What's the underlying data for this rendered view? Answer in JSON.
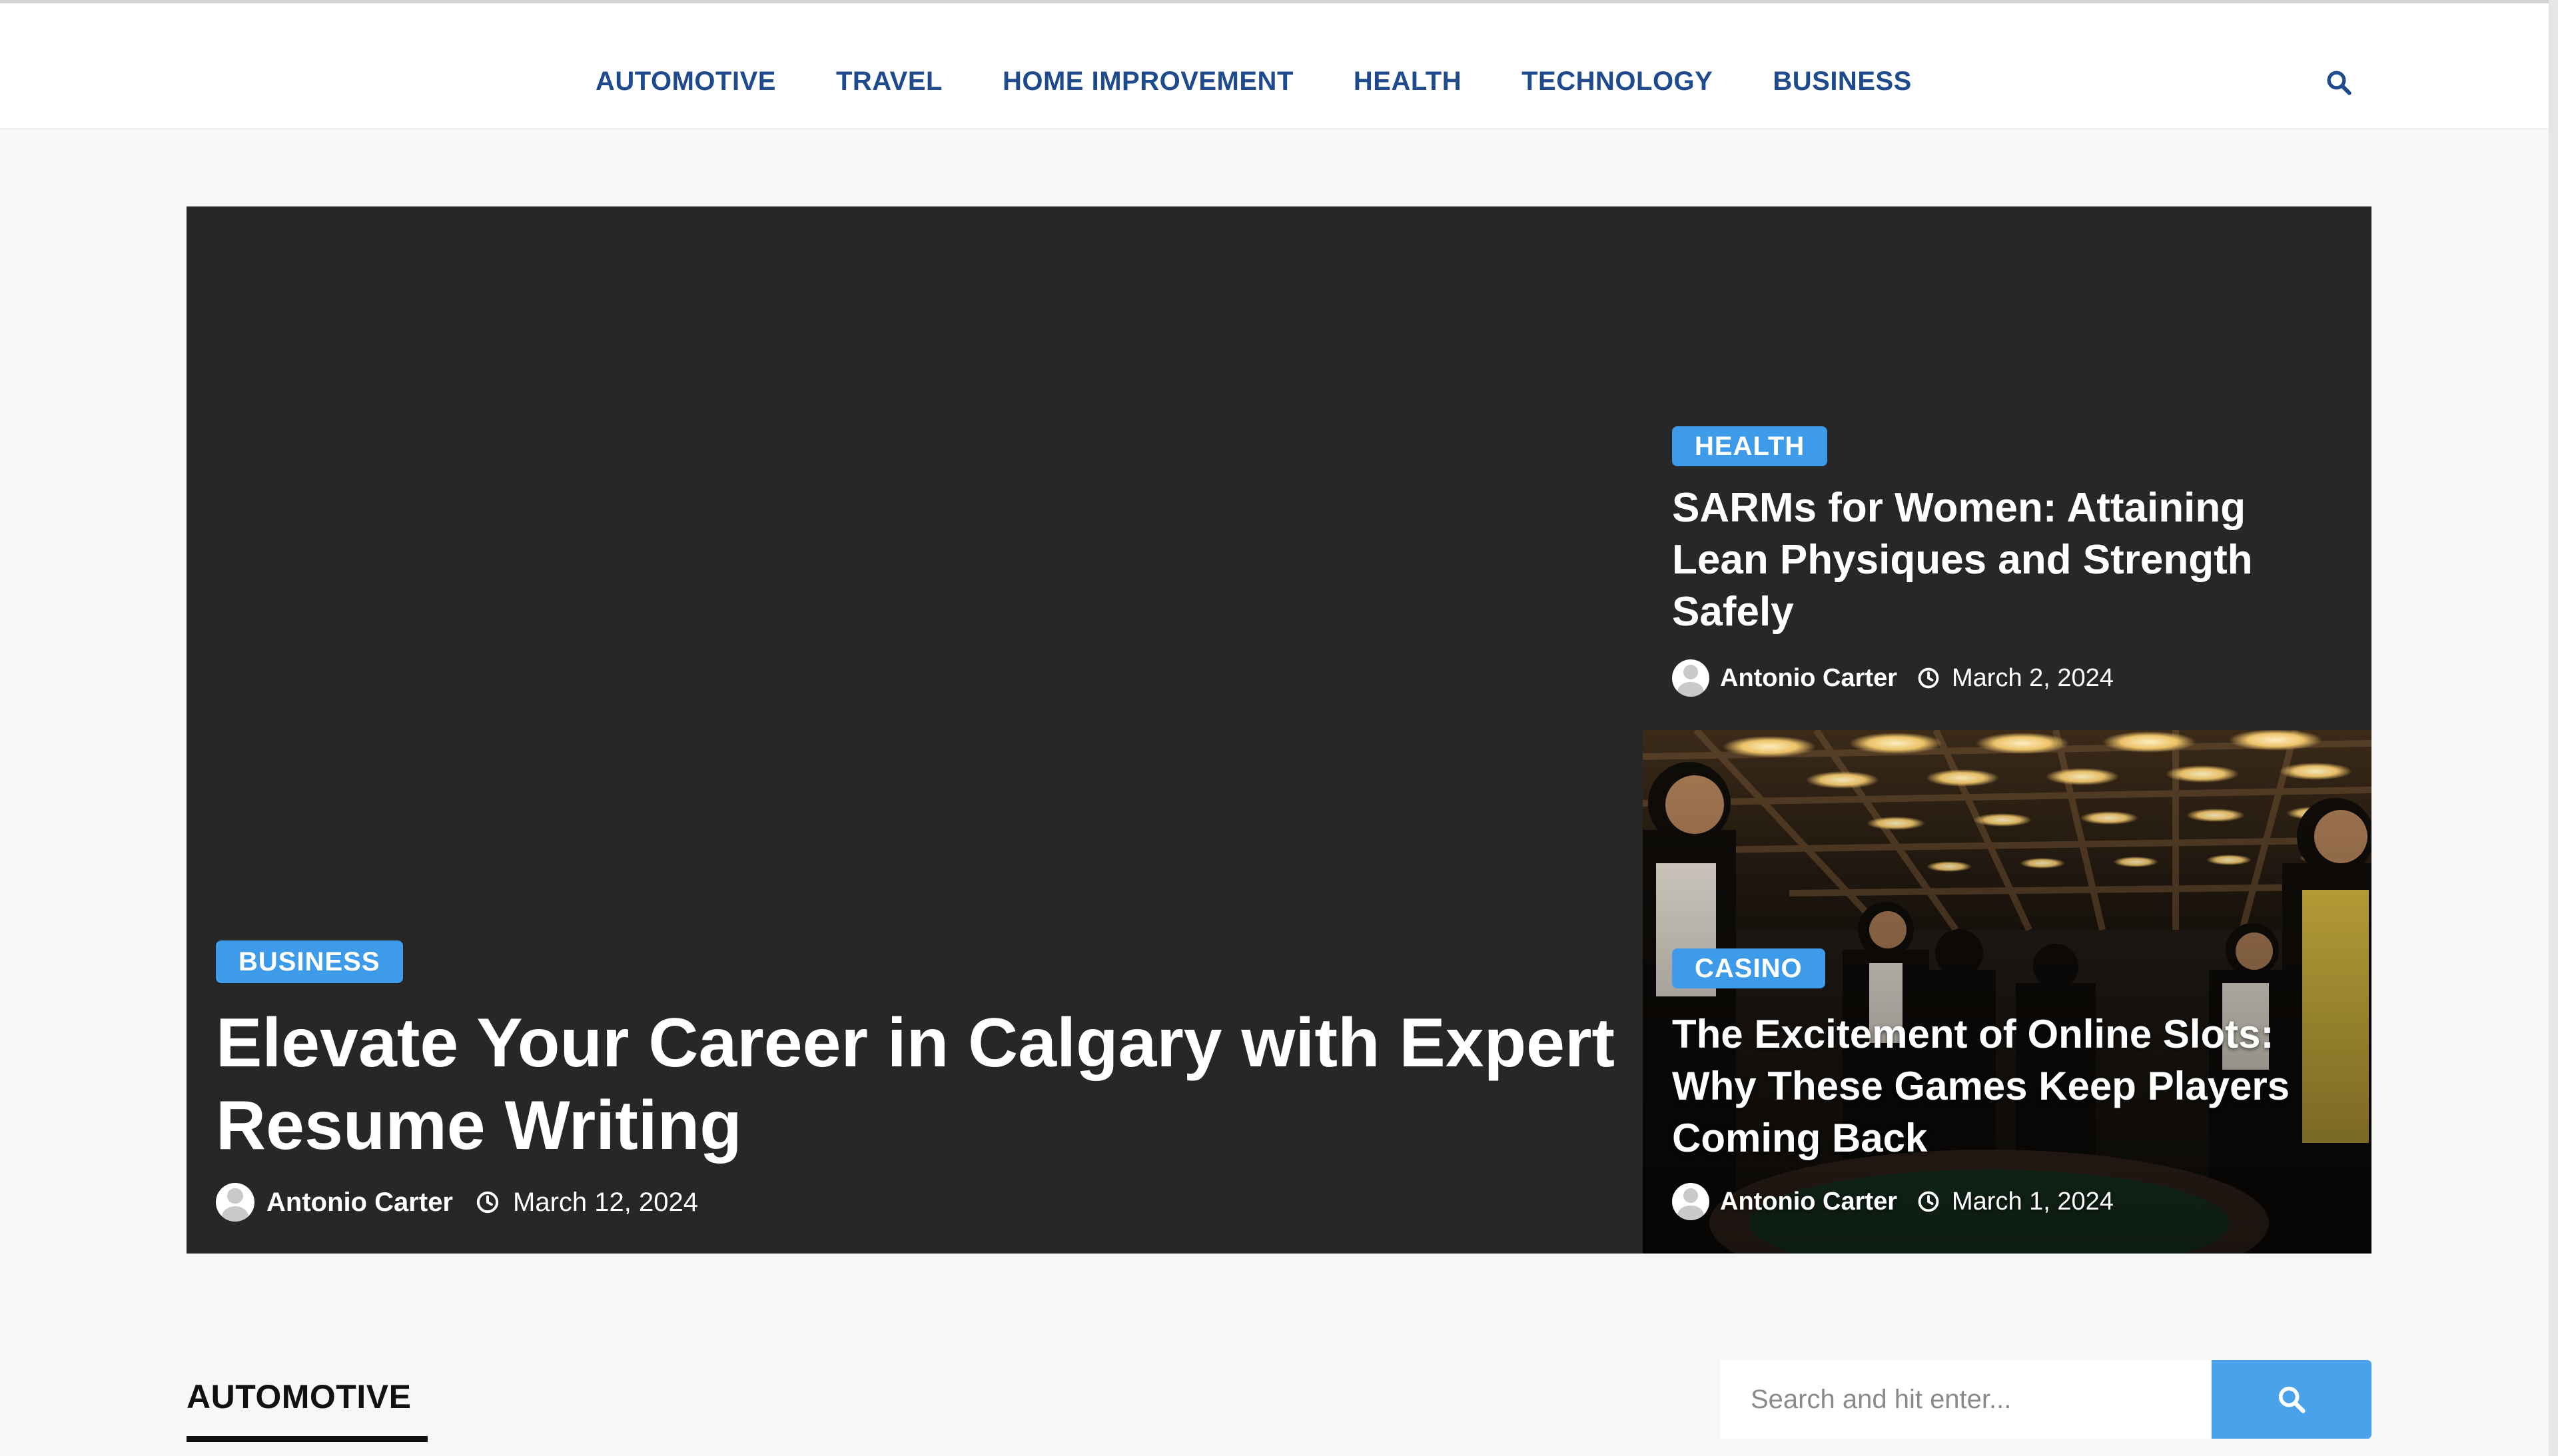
{
  "nav": {
    "items": [
      "AUTOMOTIVE",
      "TRAVEL",
      "HOME IMPROVEMENT",
      "HEALTH",
      "TECHNOLOGY",
      "BUSINESS"
    ],
    "search_icon": "search-icon"
  },
  "hero": {
    "main": {
      "category": "BUSINESS",
      "title": "Elevate Your Career in Calgary with Expert Resume Writing",
      "author": "Antonio Carter",
      "date": "March 12, 2024"
    },
    "side1": {
      "category": "HEALTH",
      "title": "SARMs for Women: Attaining Lean Physiques and Strength Safely",
      "author": "Antonio Carter",
      "date": "March 2, 2024"
    },
    "side2": {
      "category": "CASINO",
      "title": "The Excitement of Online Slots: Why These Games Keep Players Coming Back",
      "author": "Antonio Carter",
      "date": "March 1, 2024"
    }
  },
  "section": {
    "title": "AUTOMOTIVE"
  },
  "search": {
    "placeholder": "Search and hit enter...",
    "icon": "search-icon"
  },
  "colors": {
    "nav_text": "#1f4b8e",
    "badge": "#3d9be9",
    "hero_bg": "#272727",
    "search_button": "#4aa3ea"
  }
}
